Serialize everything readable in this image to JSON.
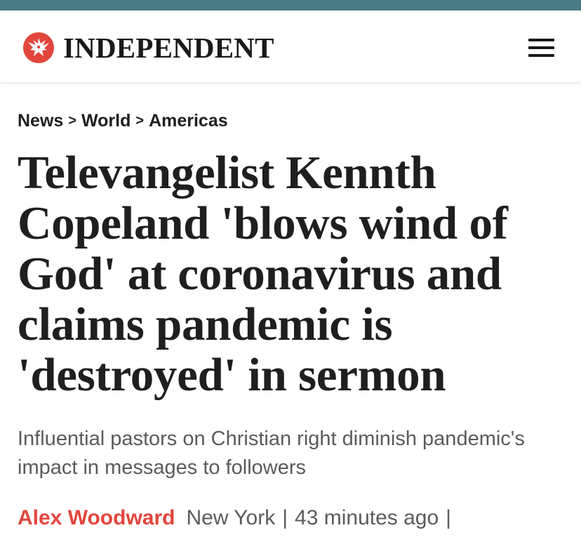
{
  "colors": {
    "top_strip": "#4a7a85",
    "brand_red": "#e2463d",
    "text_dark": "#1f1f1f",
    "text_muted": "#5b5b5b"
  },
  "header": {
    "logo_text": "INDEPENDENT",
    "logo_icon": "eagle-icon",
    "menu_icon": "hamburger-menu-icon"
  },
  "breadcrumb": {
    "items": [
      "News",
      "World",
      "Americas"
    ],
    "separator": ">"
  },
  "article": {
    "headline": "Televangelist Kennth Copeland 'blows wind of God' at coronavirus and claims pandemic is 'destroyed' in sermon",
    "standfirst": "Influential pastors on Christian right diminish pandemic's impact in messages to followers",
    "author": "Alex Woodward",
    "location": "New York",
    "divider": "|",
    "time": "43 minutes ago",
    "trailing_divider": "|"
  }
}
